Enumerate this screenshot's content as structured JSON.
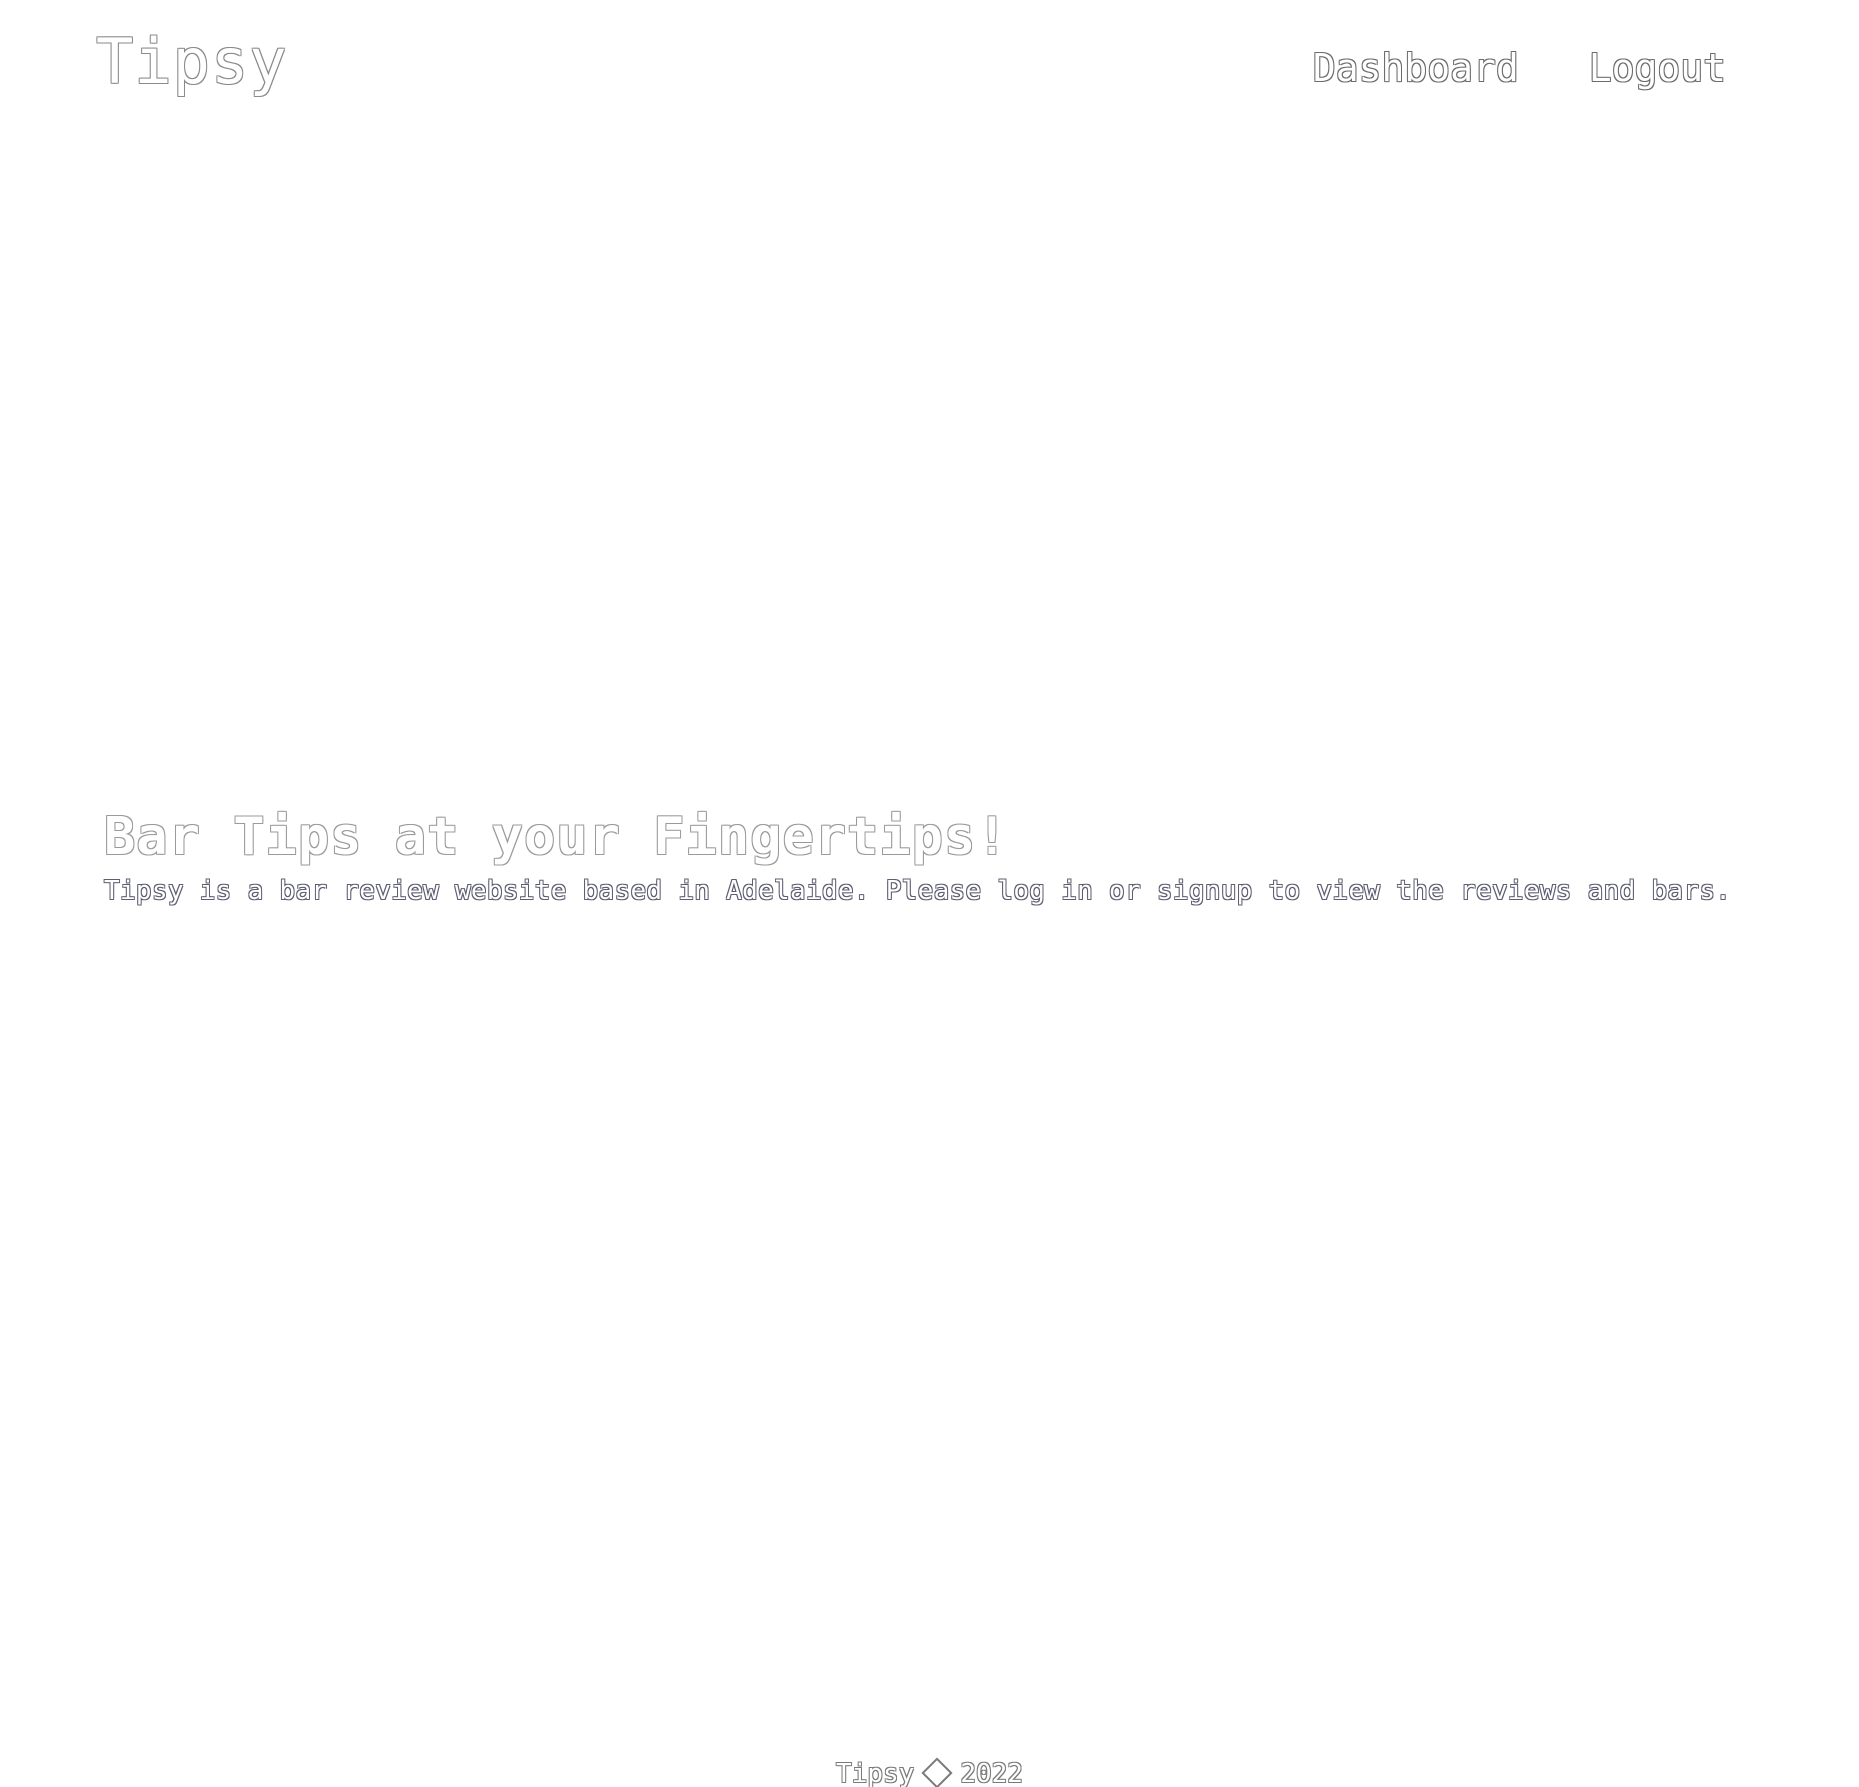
{
  "header": {
    "brand": "Tipsy",
    "nav": [
      {
        "label": "Dashboard"
      },
      {
        "label": "Logout"
      }
    ]
  },
  "hero": {
    "title": "Bar Tips at your Fingertips!",
    "subtitle": "Tipsy is a bar review website based in Adelaide. Please log in or signup to view the reviews and bars."
  },
  "footer": {
    "brand": "Tipsy",
    "icon": "copyright-icon",
    "year": "2022"
  }
}
